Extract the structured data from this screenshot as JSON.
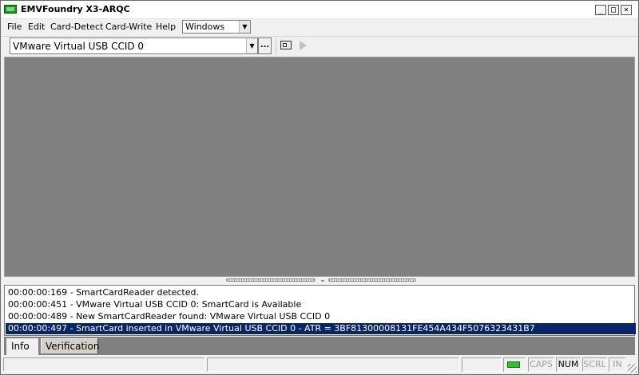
{
  "window": {
    "title": "EMVFoundry X3-ARQC"
  },
  "menu": [
    {
      "label": "File"
    },
    {
      "label": "Edit"
    },
    {
      "label": "Card-Detect"
    },
    {
      "label": "Card-Write"
    },
    {
      "label": "Help"
    }
  ],
  "window_select": {
    "value": "Windows"
  },
  "toolbar": {
    "reader_value": "VMware Virtual USB CCID 0",
    "browse_label": "..."
  },
  "log": [
    "00:00:00:169 - SmartCardReader detected.",
    "00:00:00:451 - VMware Virtual USB CCID 0: SmartCard is Available",
    "00:00:00:489 - New SmartCardReader found: VMware Virtual USB CCID 0",
    "00:00:00:497 - SmartCard inserted in VMware Virtual USB CCID 0 - ATR = 3BF81300008131FE454A434F5076323431B7"
  ],
  "tabs": [
    {
      "label": "Info"
    },
    {
      "label": "Verification"
    }
  ],
  "status": {
    "caps": "CAPS",
    "num": "NUM",
    "scrl": "SCRL",
    "ins": "IN"
  },
  "colors": {
    "mdi_background": "#808080",
    "log_selection": "#0a246a",
    "led": "#2fc42f"
  },
  "icons": [
    "app-icon",
    "minimize-icon",
    "maximize-icon",
    "close-icon",
    "chevron-down-icon",
    "card-icon",
    "play-icon",
    "size-grip-icon"
  ]
}
